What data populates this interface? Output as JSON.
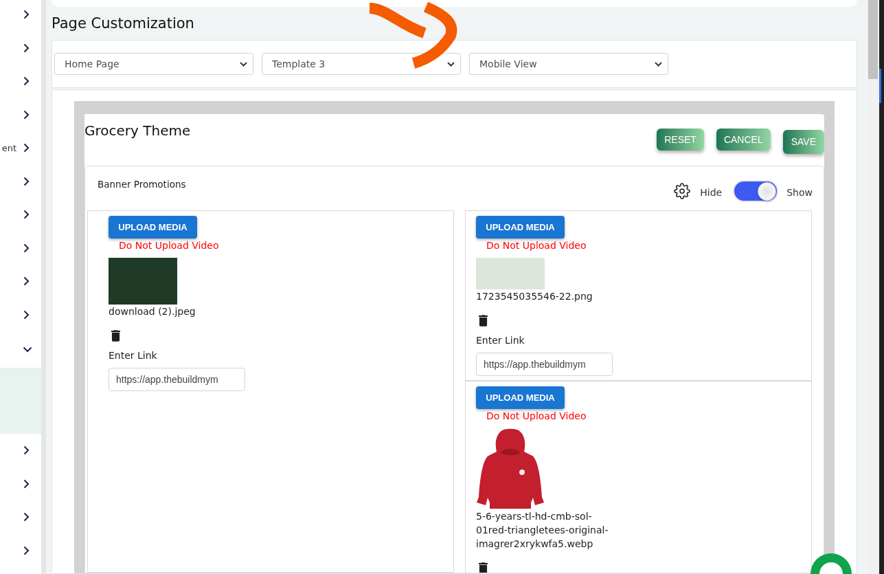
{
  "sidebar": {
    "items": [
      {
        "expanded": false
      },
      {
        "expanded": false
      },
      {
        "expanded": false
      },
      {
        "expanded": false
      },
      {
        "label": "ent",
        "expanded": false
      },
      {
        "expanded": false
      },
      {
        "expanded": false
      },
      {
        "expanded": false
      },
      {
        "expanded": false
      },
      {
        "expanded": false
      },
      {
        "expanded": true,
        "children": [
          {
            "selected": true
          }
        ]
      },
      {
        "expanded": false
      },
      {
        "expanded": false
      },
      {
        "expanded": false
      },
      {
        "expanded": false
      }
    ]
  },
  "page": {
    "title": "Page Customization"
  },
  "selectors": [
    {
      "value": "Home Page"
    },
    {
      "value": "Template 3"
    },
    {
      "value": "Mobile View"
    }
  ],
  "theme": {
    "title": "Grocery Theme",
    "buttons": [
      {
        "label": "RESET"
      },
      {
        "label": "CANCEL"
      },
      {
        "label": "SAVE"
      }
    ]
  },
  "section": {
    "title": "Banner Promotions",
    "hide_label": "Hide",
    "show_label": "Show",
    "visible": true,
    "columns": [
      {
        "cards": [
          {
            "button": "UPLOAD MEDIA",
            "warning": "Do Not Upload Video",
            "image": {
              "kind": "flowers"
            },
            "file_name": "download (2).jpeg",
            "link_label": "Enter Link",
            "link_value": "https://app.thebuildmym"
          }
        ]
      },
      {
        "cards": [
          {
            "button": "UPLOAD MEDIA",
            "warning": "Do Not Upload Video",
            "image": {
              "kind": "banner"
            },
            "file_name": "1723545035546-22.png",
            "link_label": "Enter Link",
            "link_value": "https://app.thebuildmym"
          },
          {
            "button": "UPLOAD MEDIA",
            "warning": "Do Not Upload Video",
            "image": {
              "kind": "hoodie"
            },
            "file_name": "5-6-years-tl-hd-cmb-sol-01red-triangletees-original-imagrer2xrykwfa5.webp"
          }
        ]
      }
    ]
  }
}
